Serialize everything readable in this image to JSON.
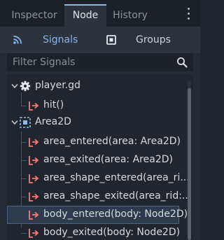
{
  "tabs": {
    "inspector": "Inspector",
    "node": "Node",
    "history": "History",
    "active": "Node"
  },
  "switcher": {
    "signals": "Signals",
    "groups": "Groups",
    "active": "Signals"
  },
  "filter": {
    "value": "",
    "placeholder": "Filter Signals"
  },
  "tree": {
    "sections": [
      {
        "label": "player.gd",
        "icon": "gear-icon",
        "expanded": true,
        "signals": [
          {
            "label": "hit()",
            "selected": false
          }
        ]
      },
      {
        "label": "Area2D",
        "icon": "area2d-node-icon",
        "expanded": true,
        "signals": [
          {
            "label": "area_entered(area: Area2D)",
            "selected": false
          },
          {
            "label": "area_exited(area: Area2D)",
            "selected": false
          },
          {
            "label": "area_shape_entered(area_ri...",
            "selected": false
          },
          {
            "label": "area_shape_exited(area_rid:...",
            "selected": false
          },
          {
            "label": "body_entered(body: Node2D)",
            "selected": true
          },
          {
            "label": "body_exited(body: Node2D)",
            "selected": false
          }
        ]
      }
    ]
  },
  "colors": {
    "accent": "#86b5f0",
    "signal_icon": "#f47a7a",
    "area2d_icon": "#8eb6ea",
    "selection": "#2f3b4c"
  }
}
